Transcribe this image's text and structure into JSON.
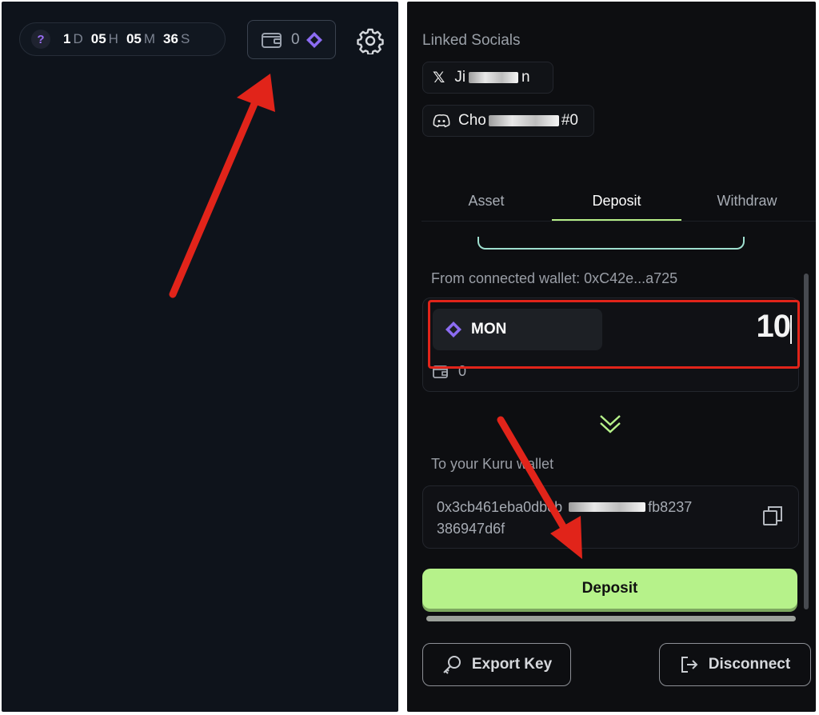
{
  "left_header": {
    "timer": [
      {
        "value": "1",
        "unit": "D"
      },
      {
        "value": "05",
        "unit": "H"
      },
      {
        "value": "05",
        "unit": "M"
      },
      {
        "value": "36",
        "unit": "S"
      }
    ],
    "help_icon": "?",
    "wallet_count": "0",
    "icons": [
      "wallet-icon",
      "mon-token-icon",
      "gear-icon"
    ]
  },
  "linked_socials": {
    "title": "Linked Socials",
    "x_account": {
      "prefix": "Ji",
      "suffix": "n"
    },
    "discord_account": {
      "prefix": "Cho",
      "suffix": "#0"
    }
  },
  "tabs": [
    "Asset",
    "Deposit",
    "Withdraw"
  ],
  "active_tab": "Deposit",
  "deposit": {
    "from_label": "From connected wallet: 0xC42e...a725",
    "token": "MON",
    "amount": "10",
    "balance": "0",
    "to_label": "To your Kuru wallet",
    "address_line1_start": "0x3cb461eba0",
    "address_line1_mid": "dbcb",
    "address_line1_end": "fb8237",
    "address_line2": "386947d6f",
    "deposit_button": "Deposit"
  },
  "bottom_buttons": {
    "export": "Export Key",
    "disconnect": "Disconnect"
  },
  "colors": {
    "accent_green": "#b6f28a",
    "token_purple": "#8c6cf2",
    "annotation_red": "#e1241a"
  }
}
